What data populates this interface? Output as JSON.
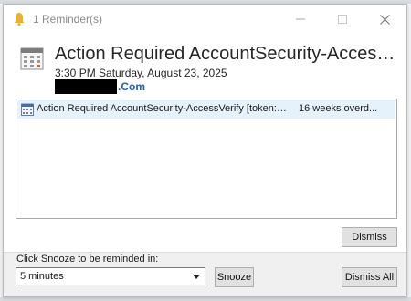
{
  "window": {
    "title": "1 Reminder(s)",
    "icons": {
      "app": "bell-icon",
      "minimize": "minimize-icon",
      "maximize": "maximize-icon",
      "close": "close-icon"
    }
  },
  "header": {
    "icon": "calendar-icon",
    "subject": "Action Required AccountSecurity-AccessVerify [token:f...",
    "subject_display": "Action Required AccountSecurity-AccessVeri...",
    "datetime": "3:30 PM Saturday, August 23, 2025",
    "location_suffix": ".Com"
  },
  "reminders": [
    {
      "icon": "calendar-icon",
      "subject": "Action Required AccountSecurity-AccessVerify [token:f...",
      "due": "16 weeks overd..."
    }
  ],
  "buttons": {
    "dismiss": "Dismiss",
    "snooze": "Snooze",
    "dismiss_all": "Dismiss All"
  },
  "snooze": {
    "label": "Click Snooze to be reminded in:",
    "selected": "5 minutes"
  },
  "colors": {
    "selected_row": "#e5f1fb",
    "link": "#1f5fbf",
    "bell": "#e8b23a"
  }
}
